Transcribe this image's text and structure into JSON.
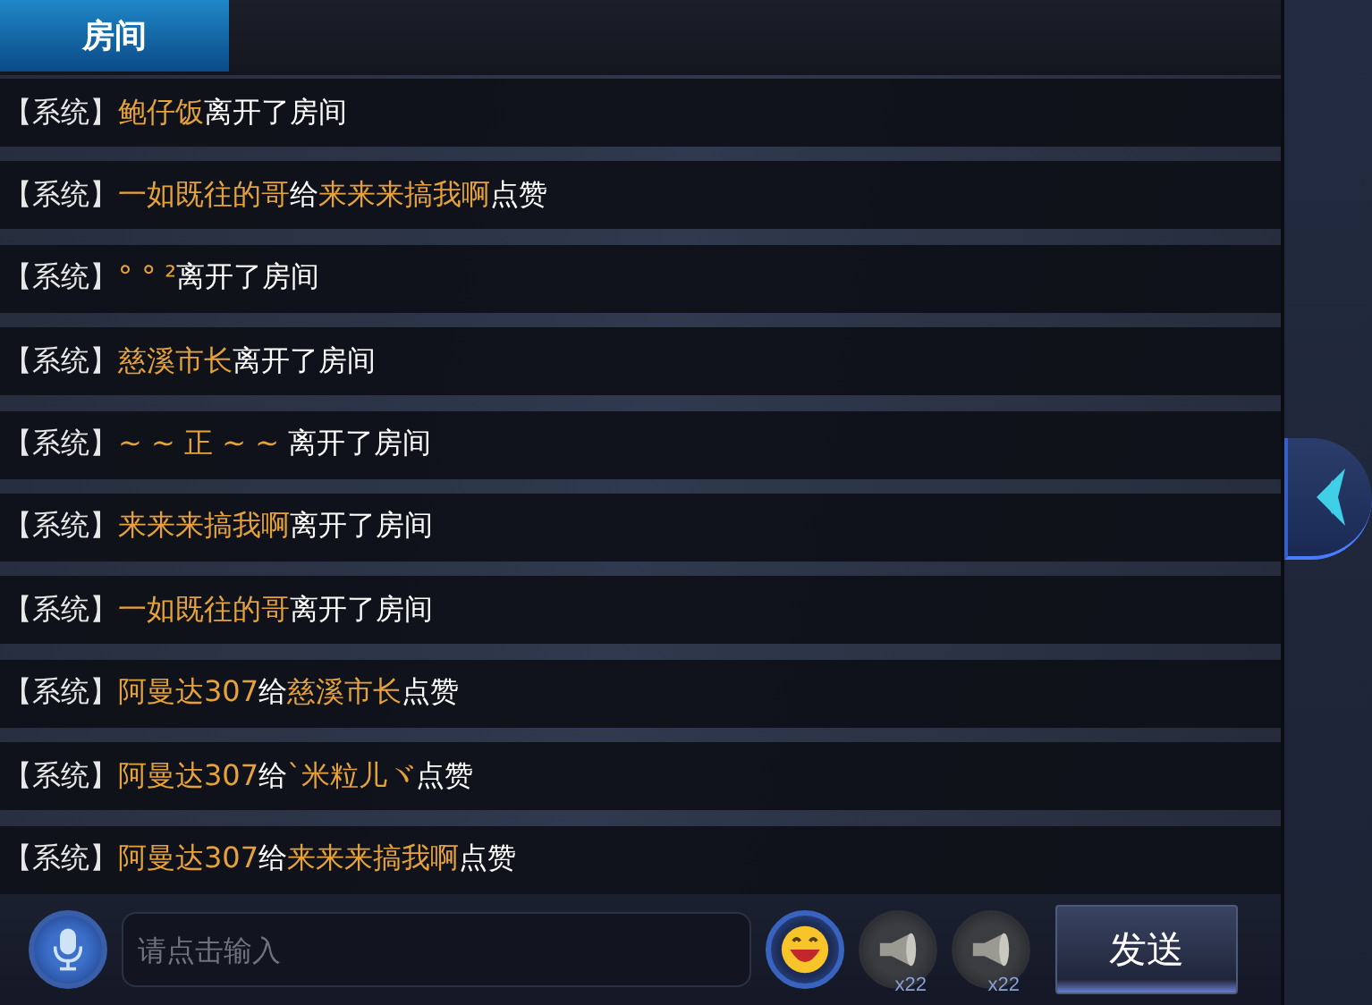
{
  "tab": {
    "label": "房间",
    "selected": true
  },
  "messages": [
    {
      "parts": [
        {
          "kind": "tag",
          "text": "【系统】"
        },
        {
          "kind": "name",
          "text": "鲍仔饭"
        },
        {
          "kind": "text",
          "text": "离开了房间"
        }
      ]
    },
    {
      "parts": [
        {
          "kind": "tag",
          "text": "【系统】"
        },
        {
          "kind": "name",
          "text": "一如既往的哥"
        },
        {
          "kind": "text",
          "text": "给"
        },
        {
          "kind": "name",
          "text": "来来来搞我啊"
        },
        {
          "kind": "text",
          "text": "点赞"
        }
      ]
    },
    {
      "parts": [
        {
          "kind": "tag",
          "text": "【系统】"
        },
        {
          "kind": "name",
          "text": "° ° ²"
        },
        {
          "kind": "text",
          "text": "离开了房间"
        }
      ]
    },
    {
      "parts": [
        {
          "kind": "tag",
          "text": "【系统】"
        },
        {
          "kind": "name",
          "text": "慈溪市长"
        },
        {
          "kind": "text",
          "text": "离开了房间"
        }
      ]
    },
    {
      "parts": [
        {
          "kind": "tag",
          "text": "【系统】"
        },
        {
          "kind": "name",
          "text": "~ ~ 正 ~ ~"
        },
        {
          "kind": "text",
          "text": " 离开了房间"
        }
      ]
    },
    {
      "parts": [
        {
          "kind": "tag",
          "text": "【系统】"
        },
        {
          "kind": "name",
          "text": "来来来搞我啊"
        },
        {
          "kind": "text",
          "text": "离开了房间"
        }
      ]
    },
    {
      "parts": [
        {
          "kind": "tag",
          "text": "【系统】"
        },
        {
          "kind": "name",
          "text": "一如既往的哥"
        },
        {
          "kind": "text",
          "text": "离开了房间"
        }
      ]
    },
    {
      "parts": [
        {
          "kind": "tag",
          "text": "【系统】"
        },
        {
          "kind": "name",
          "text": "阿曼达307"
        },
        {
          "kind": "text",
          "text": "给"
        },
        {
          "kind": "name",
          "text": "慈溪市长"
        },
        {
          "kind": "text",
          "text": "点赞"
        }
      ]
    },
    {
      "parts": [
        {
          "kind": "tag",
          "text": "【系统】"
        },
        {
          "kind": "name",
          "text": "阿曼达307"
        },
        {
          "kind": "text",
          "text": "给"
        },
        {
          "kind": "name",
          "text": "`米粒儿ヾ"
        },
        {
          "kind": "text",
          "text": "点赞"
        }
      ]
    },
    {
      "parts": [
        {
          "kind": "tag",
          "text": "【系统】"
        },
        {
          "kind": "name",
          "text": "阿曼达307"
        },
        {
          "kind": "text",
          "text": "给"
        },
        {
          "kind": "name",
          "text": "来来来搞我啊"
        },
        {
          "kind": "text",
          "text": "点赞"
        }
      ]
    }
  ],
  "input": {
    "placeholder": "请点击输入"
  },
  "horns": [
    {
      "count": "x22"
    },
    {
      "count": "x22"
    }
  ],
  "send_button": "发送"
}
